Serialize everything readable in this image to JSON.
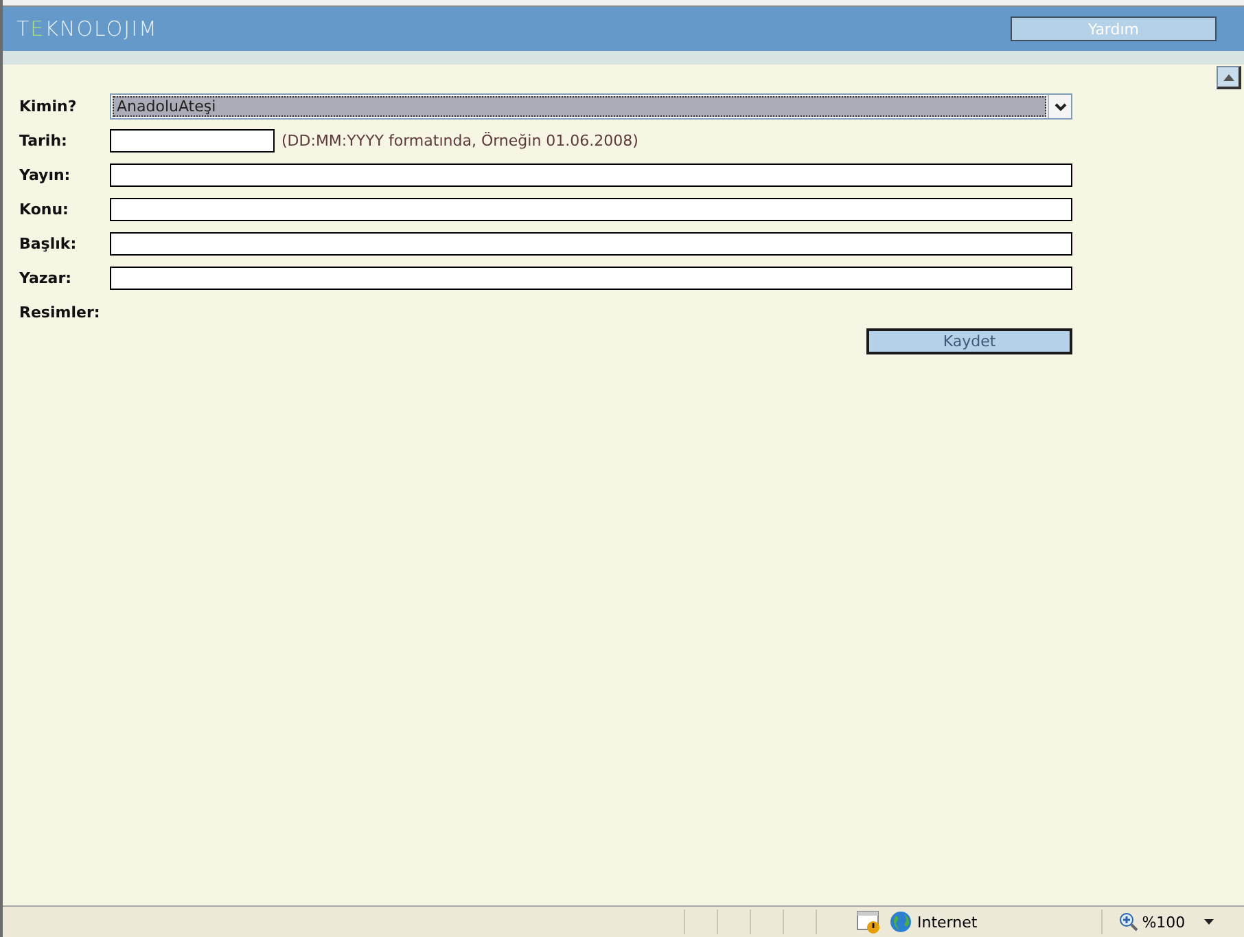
{
  "header": {
    "logo": {
      "before": "T",
      "accent": "E",
      "after": "KNOLOJIM"
    },
    "help_button": "Yardım"
  },
  "form": {
    "rows": [
      {
        "kind": "select",
        "label": "Kimin?",
        "value": "AnadoluAteşi"
      },
      {
        "kind": "date",
        "label": "Tarih:",
        "hint": "(DD:MM:YYYY formatında, Örneğin 01.06.2008)"
      },
      {
        "kind": "text",
        "label": "Yayın:"
      },
      {
        "kind": "text",
        "label": "Konu:"
      },
      {
        "kind": "text",
        "label": "Başlık:"
      },
      {
        "kind": "text",
        "label": "Yazar:"
      },
      {
        "kind": "plain",
        "label": "Resimler:"
      }
    ],
    "save_button": "Kaydet"
  },
  "status_bar": {
    "zone": "Internet",
    "zoom": "%100"
  }
}
